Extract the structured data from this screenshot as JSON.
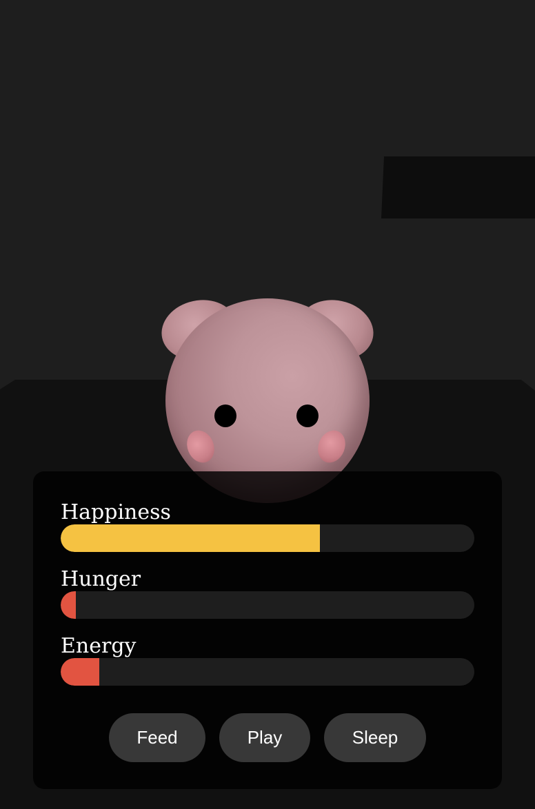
{
  "stats": [
    {
      "label": "Happiness",
      "value": 0.627,
      "color": "#f5c242"
    },
    {
      "label": "Hunger",
      "value": 0.037,
      "color": "#e25441"
    },
    {
      "label": "Energy",
      "value": 0.093,
      "color": "#e25441"
    }
  ],
  "actions": {
    "feed_label": "Feed",
    "play_label": "Play",
    "sleep_label": "Sleep"
  },
  "colors": {
    "background": "#1e1e1e",
    "floor": "#111111",
    "panel": "#000000",
    "button": "#383838",
    "pet_body": "#bd9399"
  }
}
